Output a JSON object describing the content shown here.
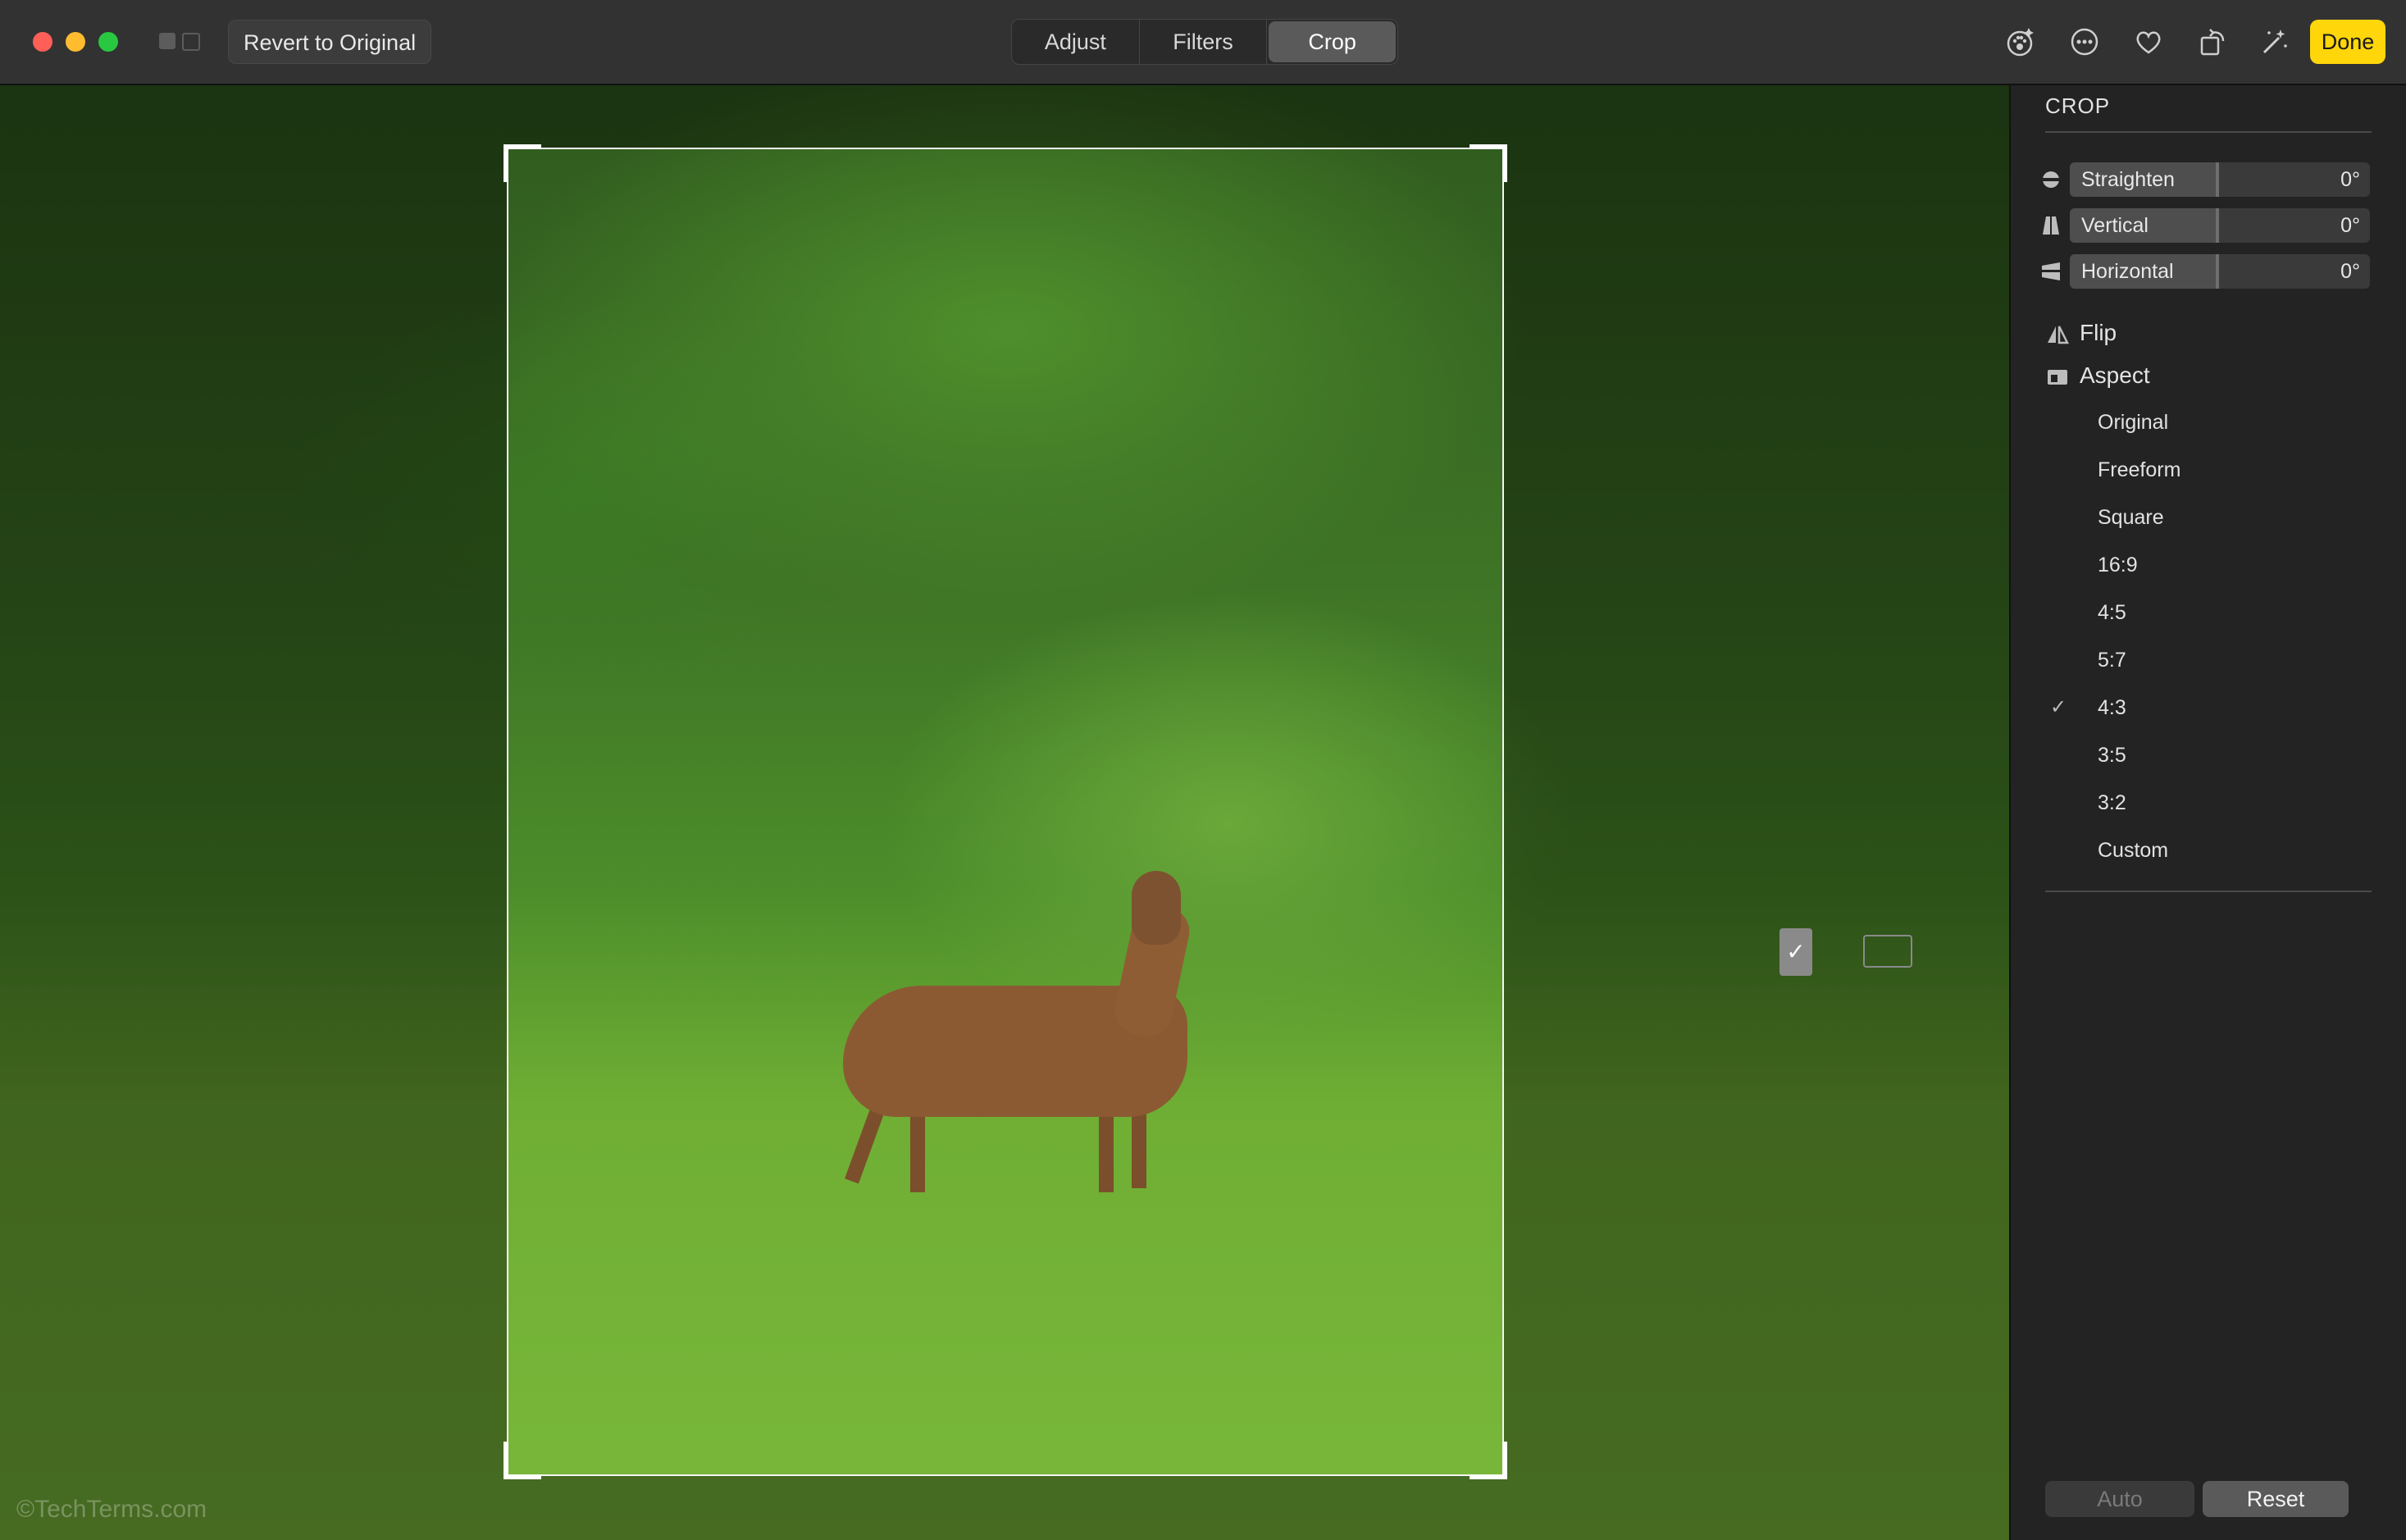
{
  "toolbar": {
    "revert_label": "Revert to Original",
    "tabs": [
      {
        "label": "Adjust"
      },
      {
        "label": "Filters"
      },
      {
        "label": "Crop",
        "active": true
      }
    ],
    "icons": [
      "pets-badge-icon",
      "more-icon",
      "heart-icon",
      "rotate-icon",
      "magic-wand-icon"
    ],
    "done_label": "Done",
    "colors": {
      "done": "#fed60a",
      "close": "#fe5f57",
      "minimize": "#febc2e",
      "maximize": "#28c840"
    }
  },
  "canvas": {
    "watermark": "©TechTerms.com",
    "photo_subject": "deer-in-meadow"
  },
  "panel": {
    "title": "CROP",
    "sliders": [
      {
        "label": "Straighten",
        "value": "0°",
        "icon": "straighten-icon"
      },
      {
        "label": "Vertical",
        "value": "0°",
        "icon": "vertical-perspective-icon"
      },
      {
        "label": "Horizontal",
        "value": "0°",
        "icon": "horizontal-perspective-icon"
      }
    ],
    "flip_label": "Flip",
    "aspect_label": "Aspect",
    "aspect_options": [
      {
        "label": "Original",
        "checked": false
      },
      {
        "label": "Freeform",
        "checked": false
      },
      {
        "label": "Square",
        "checked": false
      },
      {
        "label": "16:9",
        "checked": false
      },
      {
        "label": "4:5",
        "checked": false
      },
      {
        "label": "5:7",
        "checked": false
      },
      {
        "label": "4:3",
        "checked": true
      },
      {
        "label": "3:5",
        "checked": false
      },
      {
        "label": "3:2",
        "checked": false
      },
      {
        "label": "Custom",
        "checked": false
      }
    ],
    "check_mark": "✓",
    "orientation_selected": "portrait",
    "auto_label": "Auto",
    "reset_label": "Reset"
  }
}
